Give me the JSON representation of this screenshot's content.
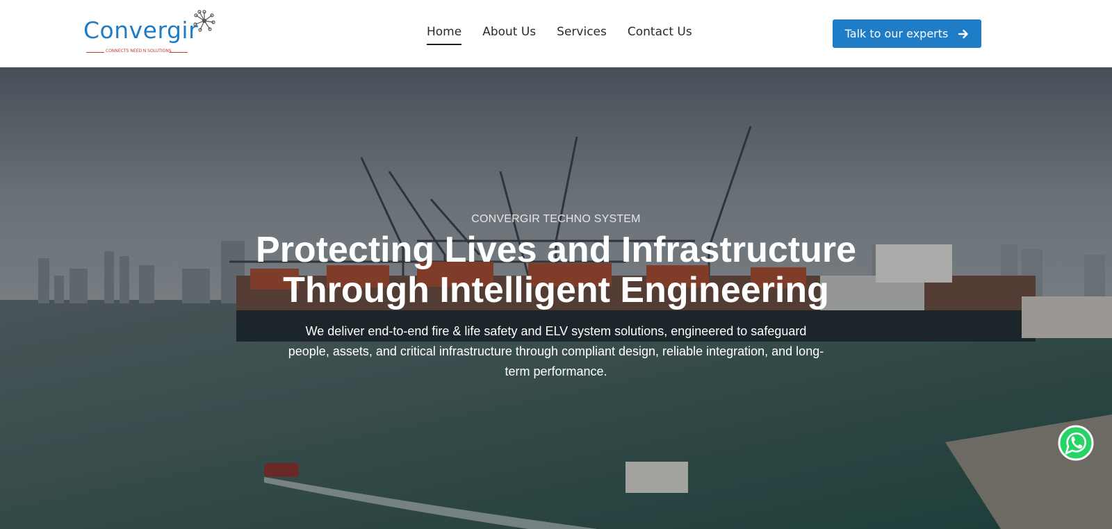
{
  "brand": {
    "name": "Convergir",
    "tagline": "CONNECTS NEED N SOLUTIONS",
    "color": "#1f7cc6"
  },
  "nav": {
    "items": [
      {
        "label": "Home",
        "active": true
      },
      {
        "label": "About Us",
        "active": false
      },
      {
        "label": "Services",
        "active": false
      },
      {
        "label": "Contact Us",
        "active": false
      }
    ]
  },
  "cta": {
    "label": "Talk to our experts",
    "icon": "arrow-right-icon"
  },
  "hero": {
    "eyebrow": "CONVERGIR TECHNO SYSTEM",
    "headline_line1": "Protecting Lives and Infrastructure",
    "headline_line2": "Through Intelligent Engineering",
    "subtext": "We deliver end-to-end fire & life safety and ELV system solutions, engineered to safeguard people, assets, and critical infrastructure through compliant design, reliable integration, and long-term performance.",
    "background": "port-harbor-cranes-image"
  },
  "floating": {
    "icon": "whatsapp-icon",
    "color": "#25d366"
  }
}
